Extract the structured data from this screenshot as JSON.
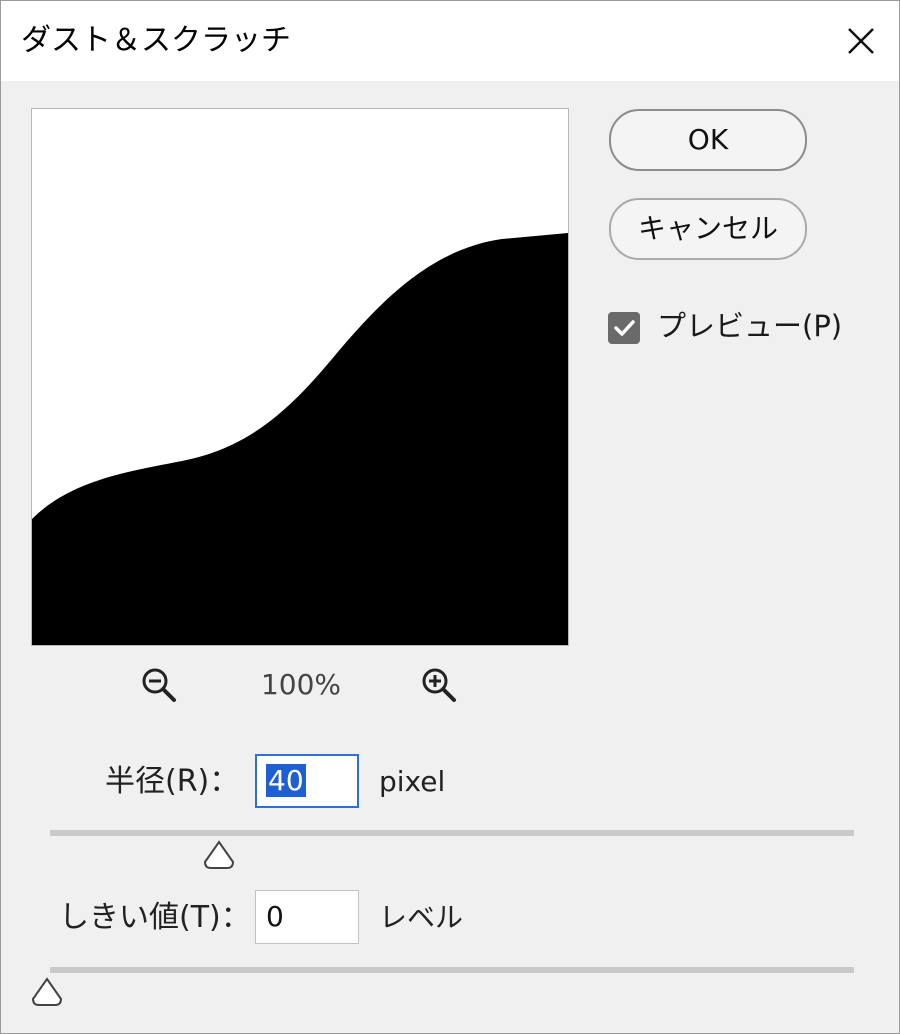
{
  "window": {
    "title": "ダスト＆スクラッチ"
  },
  "icons": {
    "close": "close-icon",
    "zoom_out": "zoom-out-icon",
    "zoom_in": "zoom-in-icon",
    "checkmark": "checkmark-icon"
  },
  "buttons": {
    "ok": "OK",
    "cancel": "キャンセル"
  },
  "preview": {
    "checkbox_label": "プレビュー(P)",
    "checked": true,
    "zoom": "100%"
  },
  "radius": {
    "label": "半径(R)：",
    "value": "40",
    "unit": "pixel"
  },
  "threshold": {
    "label": "しきい値(T)：",
    "value": "0",
    "unit": "レベル"
  },
  "colors": {
    "accent": "#1e60d2",
    "checkbox": "#6a6a6a",
    "background": "#f0f0f0"
  }
}
